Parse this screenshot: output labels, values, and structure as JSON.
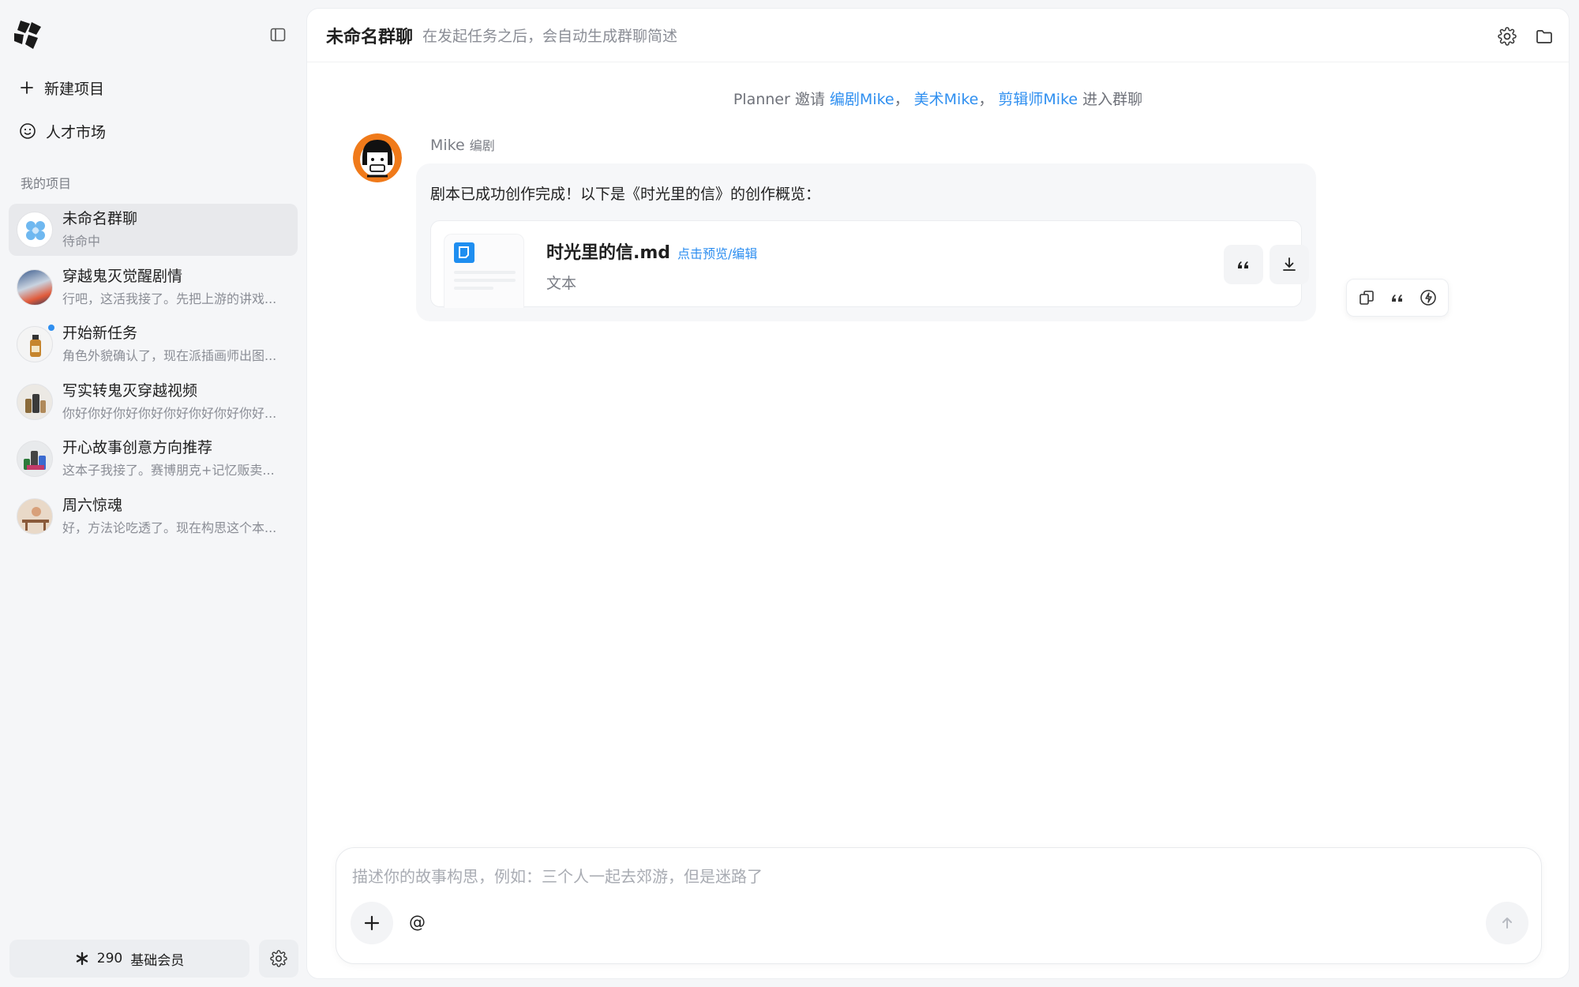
{
  "sidebar": {
    "new_project_label": "新建项目",
    "talent_market_label": "人才市场",
    "section_title": "我的项目",
    "projects": [
      {
        "title": "未命名群聊",
        "subtitle": "待命中",
        "active": true
      },
      {
        "title": "穿越鬼灭觉醒剧情",
        "subtitle": "行吧，这活我接了。先把上游的讲戏..."
      },
      {
        "title": "开始新任务",
        "subtitle": "角色外貌确认了，现在派插画师出图...",
        "unread": true
      },
      {
        "title": "写实转鬼灭穿越视频",
        "subtitle": "你好你好你好你好你好你好你好你好..."
      },
      {
        "title": "开心故事创意方向推荐",
        "subtitle": "这本子我接了。赛博朋克+记忆贩卖..."
      },
      {
        "title": "周六惊魂",
        "subtitle": "好，方法论吃透了。现在构思这个本..."
      }
    ],
    "footer": {
      "credits": "290",
      "plan": "基础会员"
    }
  },
  "header": {
    "title": "未命名群聊",
    "description": "在发起任务之后，会自动生成群聊简述"
  },
  "system_note": {
    "prefix": "Planner 邀请",
    "mentions": [
      "编剧Mike",
      "美术Mike",
      "剪辑师Mike"
    ],
    "sep": "，",
    "suffix": "进入群聊"
  },
  "message": {
    "author": "Mike",
    "role": "编剧",
    "text": "剧本已成功创作完成！以下是《时光里的信》的创作概览：",
    "file": {
      "name": "时光里的信.md",
      "link_label": "点击预览/编辑",
      "type": "文本"
    }
  },
  "composer": {
    "placeholder": "描述你的故事构思，例如：三个人一起去郊游，但是迷路了",
    "at_label": "@"
  },
  "colors": {
    "accent": "#2f8ff0",
    "file_icon": "#1f8ef0",
    "avatar_ring": "#f07a1a"
  }
}
